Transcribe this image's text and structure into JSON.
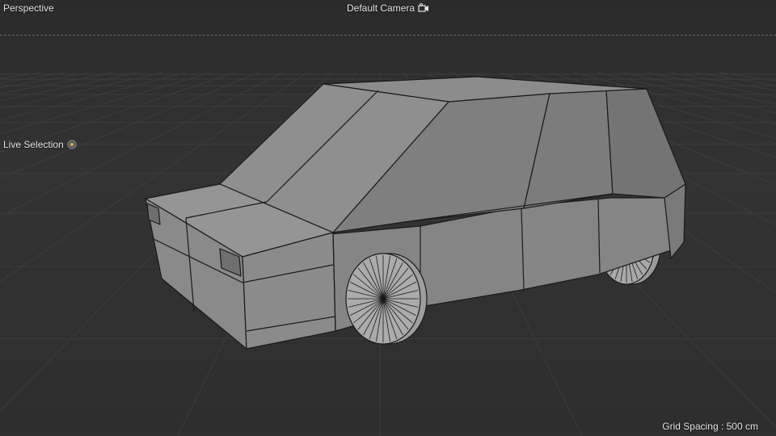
{
  "viewport": {
    "view_mode": "Perspective",
    "camera_label": "Default Camera",
    "camera_icon": "camera-icon",
    "tool_label": "Live Selection",
    "tool_icon": "tool-settings-icon",
    "grid_spacing": "Grid Spacing : 500 cm"
  },
  "colors": {
    "background": "#2f2f2f",
    "grid_line": "#3d3d3d",
    "mesh_fill": "#8e8e8e",
    "mesh_wire": "#1a1a1a",
    "hud_text": "#e6e6e6"
  },
  "scene": {
    "object": "car-model",
    "display": "gouraud-shading-with-wireframe"
  }
}
